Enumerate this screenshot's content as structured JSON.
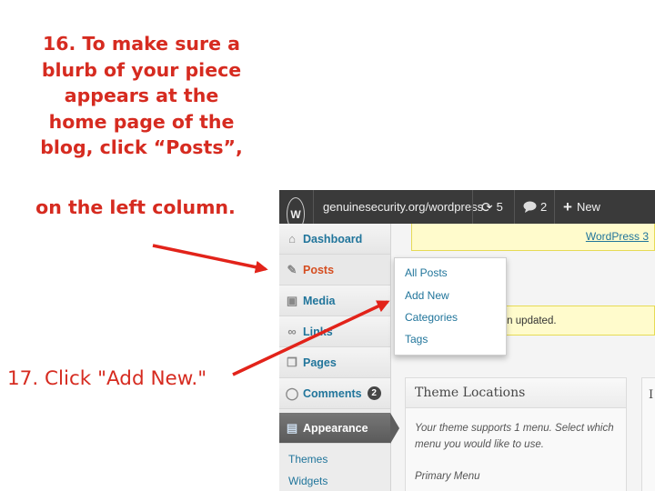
{
  "instructions": {
    "step16_lines": [
      "16. To  make sure a",
      "blurb of your piece",
      "appears at the",
      "home page of the",
      "blog, click “Posts”,"
    ],
    "step16_last": "on the left column.",
    "step17": "17. Click \"Add New.\""
  },
  "adminbar": {
    "logo": "W",
    "site": "genuinesecurity.org/wordpress",
    "updates_icon": "refresh-icon",
    "updates": "5",
    "comments_icon": "comment-bubble-icon",
    "comments": "2",
    "new_icon": "plus-icon",
    "new": "New"
  },
  "sidebar": {
    "dashboard": "Dashboard",
    "posts": "Posts",
    "media": "Media",
    "links": "Links",
    "pages": "Pages",
    "comments": "Comments",
    "comments_badge": "2",
    "appearance": "Appearance",
    "appearance_sub": [
      "Themes",
      "Widgets"
    ]
  },
  "flyout": [
    "All Posts",
    "Add New",
    "Categories",
    "Tags"
  ],
  "notices": {
    "top_link": "WordPress 3",
    "mid": "been updated."
  },
  "theme_locations": {
    "title": "Theme Locations",
    "desc": "Your theme supports 1 menu. Select which menu you would like to use.",
    "primary": "Primary Menu"
  },
  "right_box_initial": "I",
  "colors": {
    "annotation": "#d62b20",
    "admin_bar": "#3a3a3a",
    "link": "#21759b",
    "active": "#d54e21"
  }
}
